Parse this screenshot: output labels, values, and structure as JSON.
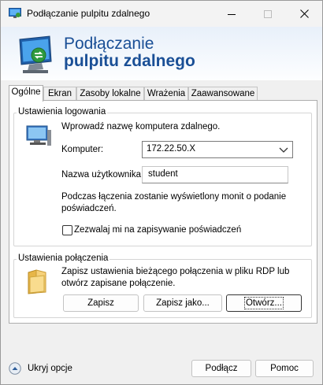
{
  "window": {
    "title": "Podłączanie pulpitu zdalnego",
    "minimize_icon": "minimize-icon",
    "maximize_icon": "maximize-icon",
    "close_icon": "close-icon"
  },
  "banner": {
    "line1": "Podłączanie",
    "line2": "pulpitu zdalnego"
  },
  "tabs": [
    {
      "label": "Ogólne",
      "active": true
    },
    {
      "label": "Ekran",
      "active": false
    },
    {
      "label": "Zasoby lokalne",
      "active": false
    },
    {
      "label": "Wrażenia",
      "active": false
    },
    {
      "label": "Zaawansowane",
      "active": false
    }
  ],
  "login_settings": {
    "legend": "Ustawienia logowania",
    "intro": "Wprowadź nazwę komputera zdalnego.",
    "computer_label": "Komputer:",
    "computer_value": "172.22.50.X",
    "username_label": "Nazwa użytkownika:",
    "username_value": "student",
    "info_line1": "Podczas łączenia zostanie wyświetlony monit o podanie",
    "info_line2": "poświadczeń.",
    "save_credentials_label": "Zezwalaj mi na zapisywanie poświadczeń",
    "save_credentials_checked": false
  },
  "connection_settings": {
    "legend": "Ustawienia połączenia",
    "info_line1": "Zapisz ustawienia bieżącego połączenia w pliku RDP lub",
    "info_line2": "otwórz zapisane połączenie.",
    "save_label": "Zapisz",
    "save_as_label": "Zapisz jako...",
    "open_label": "Otwórz..."
  },
  "footer": {
    "hide_options_label": "Ukryj opcje",
    "connect_label": "Podłącz",
    "help_label": "Pomoc"
  },
  "colors": {
    "banner_text": "#1a4f96",
    "window_bg": "#f0f0f0",
    "panel_bg": "#ffffff"
  }
}
